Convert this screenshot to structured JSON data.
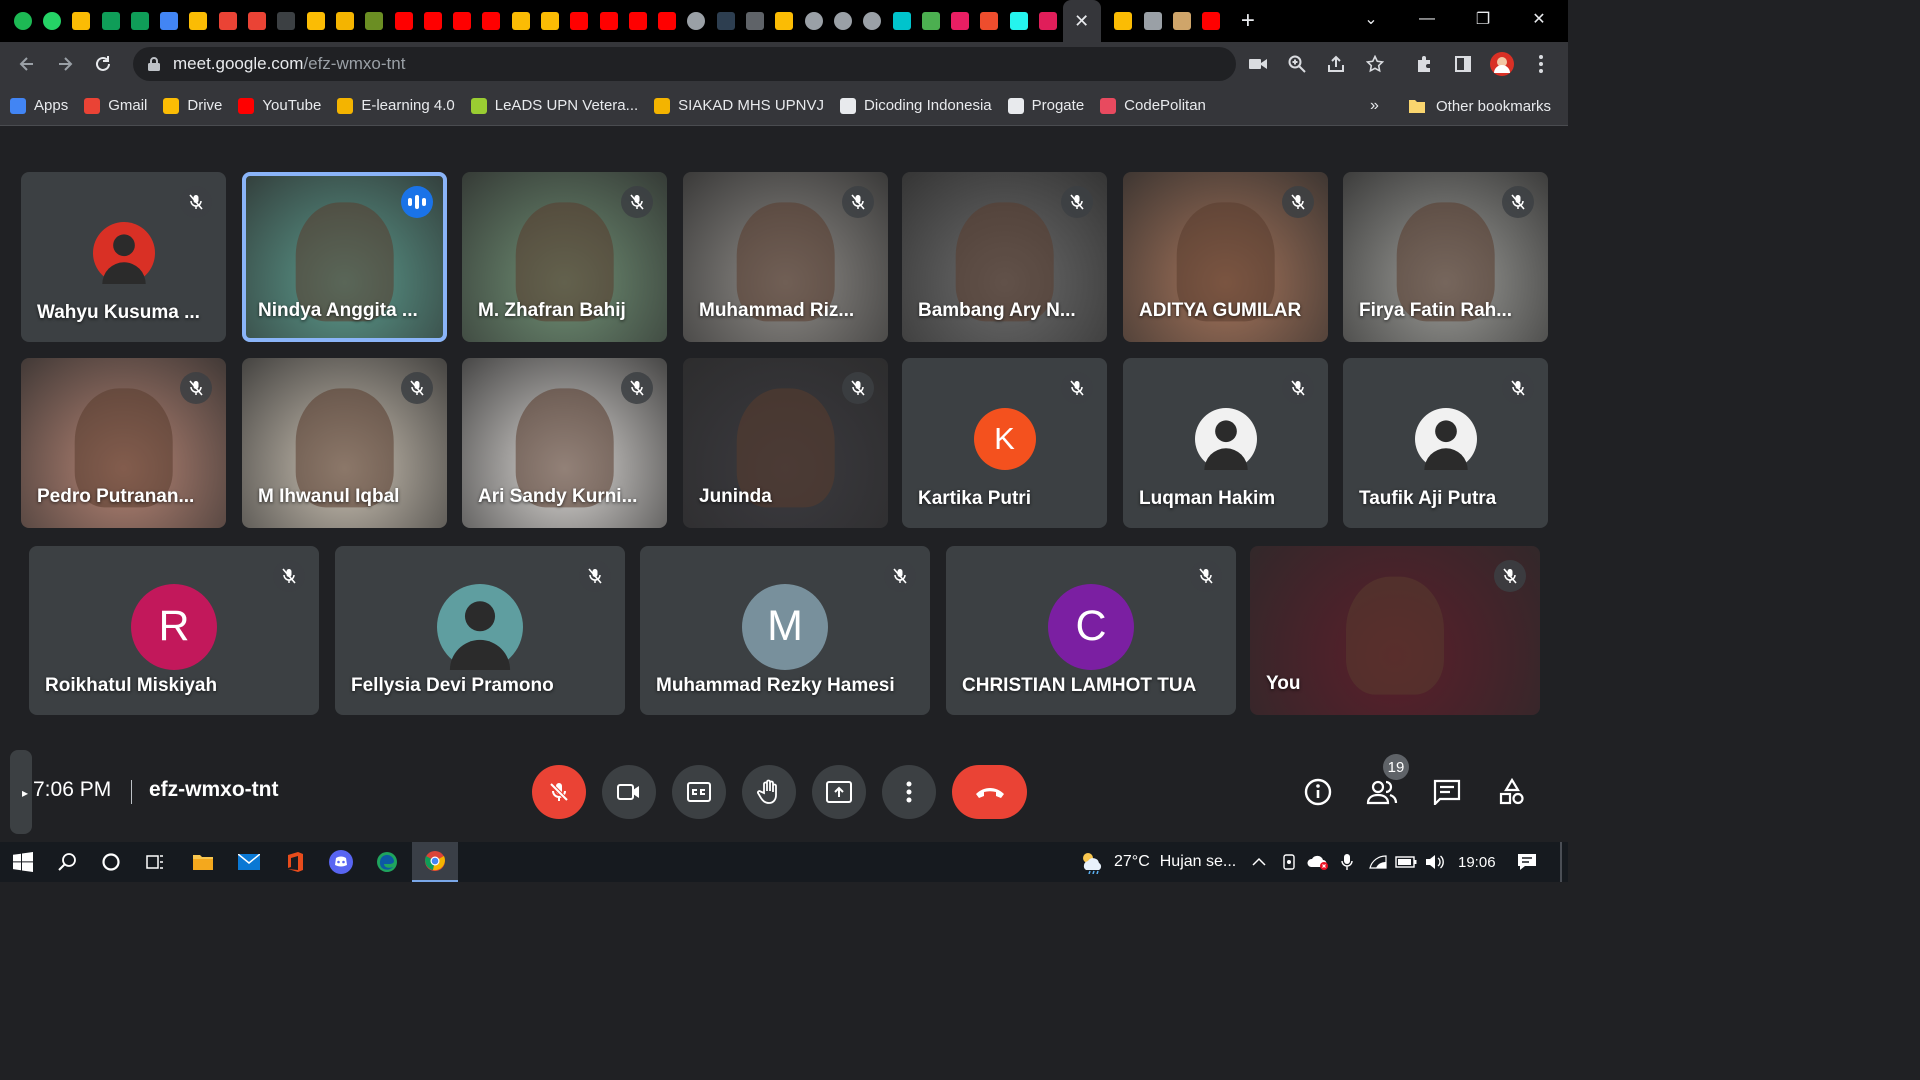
{
  "browser": {
    "tab_close_glyph": "✕",
    "new_tab_glyph": "+",
    "url_host": "meet.google.com",
    "url_path": "/efz-wmxo-tnt",
    "pinned_tab_icons": [
      {
        "name": "spotify-icon",
        "color": "#1db954",
        "round": true
      },
      {
        "name": "whatsapp-icon",
        "color": "#25d366",
        "round": true
      },
      {
        "name": "drive-icon",
        "color": "#fbbc04",
        "round": false
      },
      {
        "name": "sheets-icon",
        "color": "#0f9d58",
        "round": false
      },
      {
        "name": "sheets-icon",
        "color": "#0f9d58",
        "round": false
      },
      {
        "name": "calendar-icon",
        "color": "#4285f4",
        "round": false
      },
      {
        "name": "keep-icon",
        "color": "#fbbc04",
        "round": false
      },
      {
        "name": "gmail-icon",
        "color": "#ea4335",
        "round": false
      },
      {
        "name": "gmail-icon",
        "color": "#ea4335",
        "round": false
      },
      {
        "name": "app-icon",
        "color": "#3c4043",
        "round": false
      },
      {
        "name": "drive-icon",
        "color": "#fbbc04",
        "round": false
      },
      {
        "name": "siakad-icon",
        "color": "#f4b400",
        "round": false
      },
      {
        "name": "leads-icon",
        "color": "#6b8e23",
        "round": false
      },
      {
        "name": "youtube-icon",
        "color": "#ff0000",
        "round": false
      },
      {
        "name": "youtube-icon",
        "color": "#ff0000",
        "round": false
      },
      {
        "name": "youtube-icon",
        "color": "#ff0000",
        "round": false
      },
      {
        "name": "youtube-icon",
        "color": "#ff0000",
        "round": false
      },
      {
        "name": "drive-icon",
        "color": "#fbbc04",
        "round": false
      },
      {
        "name": "drive-icon",
        "color": "#fbbc04",
        "round": false
      },
      {
        "name": "youtube-icon",
        "color": "#ff0000",
        "round": false
      },
      {
        "name": "youtube-icon",
        "color": "#ff0000",
        "round": false
      },
      {
        "name": "youtube-icon",
        "color": "#ff0000",
        "round": false
      },
      {
        "name": "youtube-icon",
        "color": "#ff0000",
        "round": false
      },
      {
        "name": "globe-icon",
        "color": "#9aa0a6",
        "round": true
      },
      {
        "name": "dicoding-icon",
        "color": "#2d3e50",
        "round": false
      },
      {
        "name": "app-icon",
        "color": "#5f6368",
        "round": false
      },
      {
        "name": "drive-icon",
        "color": "#fbbc04",
        "round": false
      },
      {
        "name": "globe-icon",
        "color": "#9aa0a6",
        "round": true
      },
      {
        "name": "globe-icon",
        "color": "#9aa0a6",
        "round": true
      },
      {
        "name": "globe-icon",
        "color": "#9aa0a6",
        "round": true
      },
      {
        "name": "app-icon",
        "color": "#00c4cc",
        "round": false
      },
      {
        "name": "app-icon",
        "color": "#4caf50",
        "round": false
      },
      {
        "name": "app-icon",
        "color": "#e91e63",
        "round": false
      },
      {
        "name": "shopee-icon",
        "color": "#ee4d2d",
        "round": false
      },
      {
        "name": "tiktok-icon",
        "color": "#25f4ee",
        "round": false
      },
      {
        "name": "slack-icon",
        "color": "#e01e5a",
        "round": false
      }
    ],
    "after_tab_icons": [
      {
        "name": "drive-icon",
        "color": "#fbbc04"
      },
      {
        "name": "app-icon",
        "color": "#9aa0a6"
      },
      {
        "name": "app-icon",
        "color": "#cfa56a"
      },
      {
        "name": "youtube-icon",
        "color": "#ff0000"
      }
    ],
    "window_controls": {
      "tab_search": "⌄",
      "minimize": "—",
      "restore": "❐",
      "close": "✕"
    },
    "bookmarks": [
      {
        "label": "Apps",
        "icon": "apps-icon",
        "color": "#4285f4"
      },
      {
        "label": "Gmail",
        "icon": "gmail-icon",
        "color": "#ea4335"
      },
      {
        "label": "Drive",
        "icon": "drive-icon",
        "color": "#fbbc04"
      },
      {
        "label": "YouTube",
        "icon": "youtube-icon",
        "color": "#ff0000"
      },
      {
        "label": "E-learning 4.0",
        "icon": "elearning-icon",
        "color": "#f4b400"
      },
      {
        "label": "LeADS UPN Vetera...",
        "icon": "leads-icon",
        "color": "#9acd32"
      },
      {
        "label": "SIAKAD MHS UPNVJ",
        "icon": "siakad-icon",
        "color": "#f4b400"
      },
      {
        "label": "Dicoding Indonesia",
        "icon": "dicoding-icon",
        "color": "#e8eaed"
      },
      {
        "label": "Progate",
        "icon": "progate-icon",
        "color": "#e8eaed"
      },
      {
        "label": "CodePolitan",
        "icon": "codepolitan-icon",
        "color": "#e84a5f"
      }
    ],
    "bookmarks_overflow": "»",
    "other_bookmarks": "Other bookmarks"
  },
  "meet": {
    "participants_row1": [
      {
        "name": "Wahyu Kusuma ...",
        "type": "avatar-photo",
        "bg": "#3c4043",
        "avatar_color": "#d93025",
        "speaking": false
      },
      {
        "name": "Nindya Anggita ...",
        "type": "video",
        "bg": "#5b9a8c",
        "speaking": true
      },
      {
        "name": "M. Zhafran Bahij",
        "type": "video",
        "bg": "#6f8f74",
        "speaking": false
      },
      {
        "name": "Muhammad Riz...",
        "type": "video",
        "bg": "#8d8a86",
        "speaking": false
      },
      {
        "name": "Bambang Ary N...",
        "type": "video",
        "bg": "#6b6b6b",
        "speaking": false
      },
      {
        "name": "ADITYA GUMILAR",
        "type": "video",
        "bg": "#a3735a",
        "speaking": false
      },
      {
        "name": "Firya Fatin Rah...",
        "type": "video",
        "bg": "#9a9a96",
        "speaking": false
      }
    ],
    "participants_row2": [
      {
        "name": "Pedro Putranan...",
        "type": "video",
        "bg": "#b58474",
        "speaking": false
      },
      {
        "name": "M Ihwanul Iqbal",
        "type": "video",
        "bg": "#c9c0b2",
        "speaking": false
      },
      {
        "name": "Ari Sandy Kurni...",
        "type": "video",
        "bg": "#d8d5d2",
        "speaking": false
      },
      {
        "name": "Juninda",
        "type": "video",
        "bg": "#3b3a3f",
        "speaking": false
      },
      {
        "name": "Kartika Putri",
        "type": "avatar",
        "letter": "K",
        "avatar_color": "#f4511e",
        "speaking": false
      },
      {
        "name": "Luqman Hakim",
        "type": "avatar-photo",
        "avatar_color": "#f1f1f1",
        "speaking": false
      },
      {
        "name": "Taufik Aji Putra",
        "type": "avatar-photo",
        "avatar_color": "#f1f1f1",
        "speaking": false
      }
    ],
    "participants_row3": [
      {
        "name": "Roikhatul Miskiyah",
        "type": "avatar",
        "letter": "R",
        "avatar_color": "#c2185b"
      },
      {
        "name": "Fellysia Devi Pramono",
        "type": "avatar-photo",
        "avatar_color": "#5f9ea0"
      },
      {
        "name": "Muhammad Rezky Hamesi",
        "type": "avatar",
        "letter": "M",
        "avatar_color": "#78909c"
      },
      {
        "name": "CHRISTIAN LAMHOT TUA",
        "type": "avatar",
        "letter": "C",
        "avatar_color": "#7b1fa2"
      },
      {
        "name": "You",
        "type": "video",
        "bg": "#5a1e2a"
      }
    ],
    "time": "7:06 PM",
    "meeting_code": "efz-wmxo-tnt",
    "people_count": "19",
    "accent_red": "#ea4335",
    "accent_blue": "#1a73e8"
  },
  "taskbar": {
    "weather_temp": "27°C",
    "weather_text": "Hujan se...",
    "clock": "19:06"
  }
}
